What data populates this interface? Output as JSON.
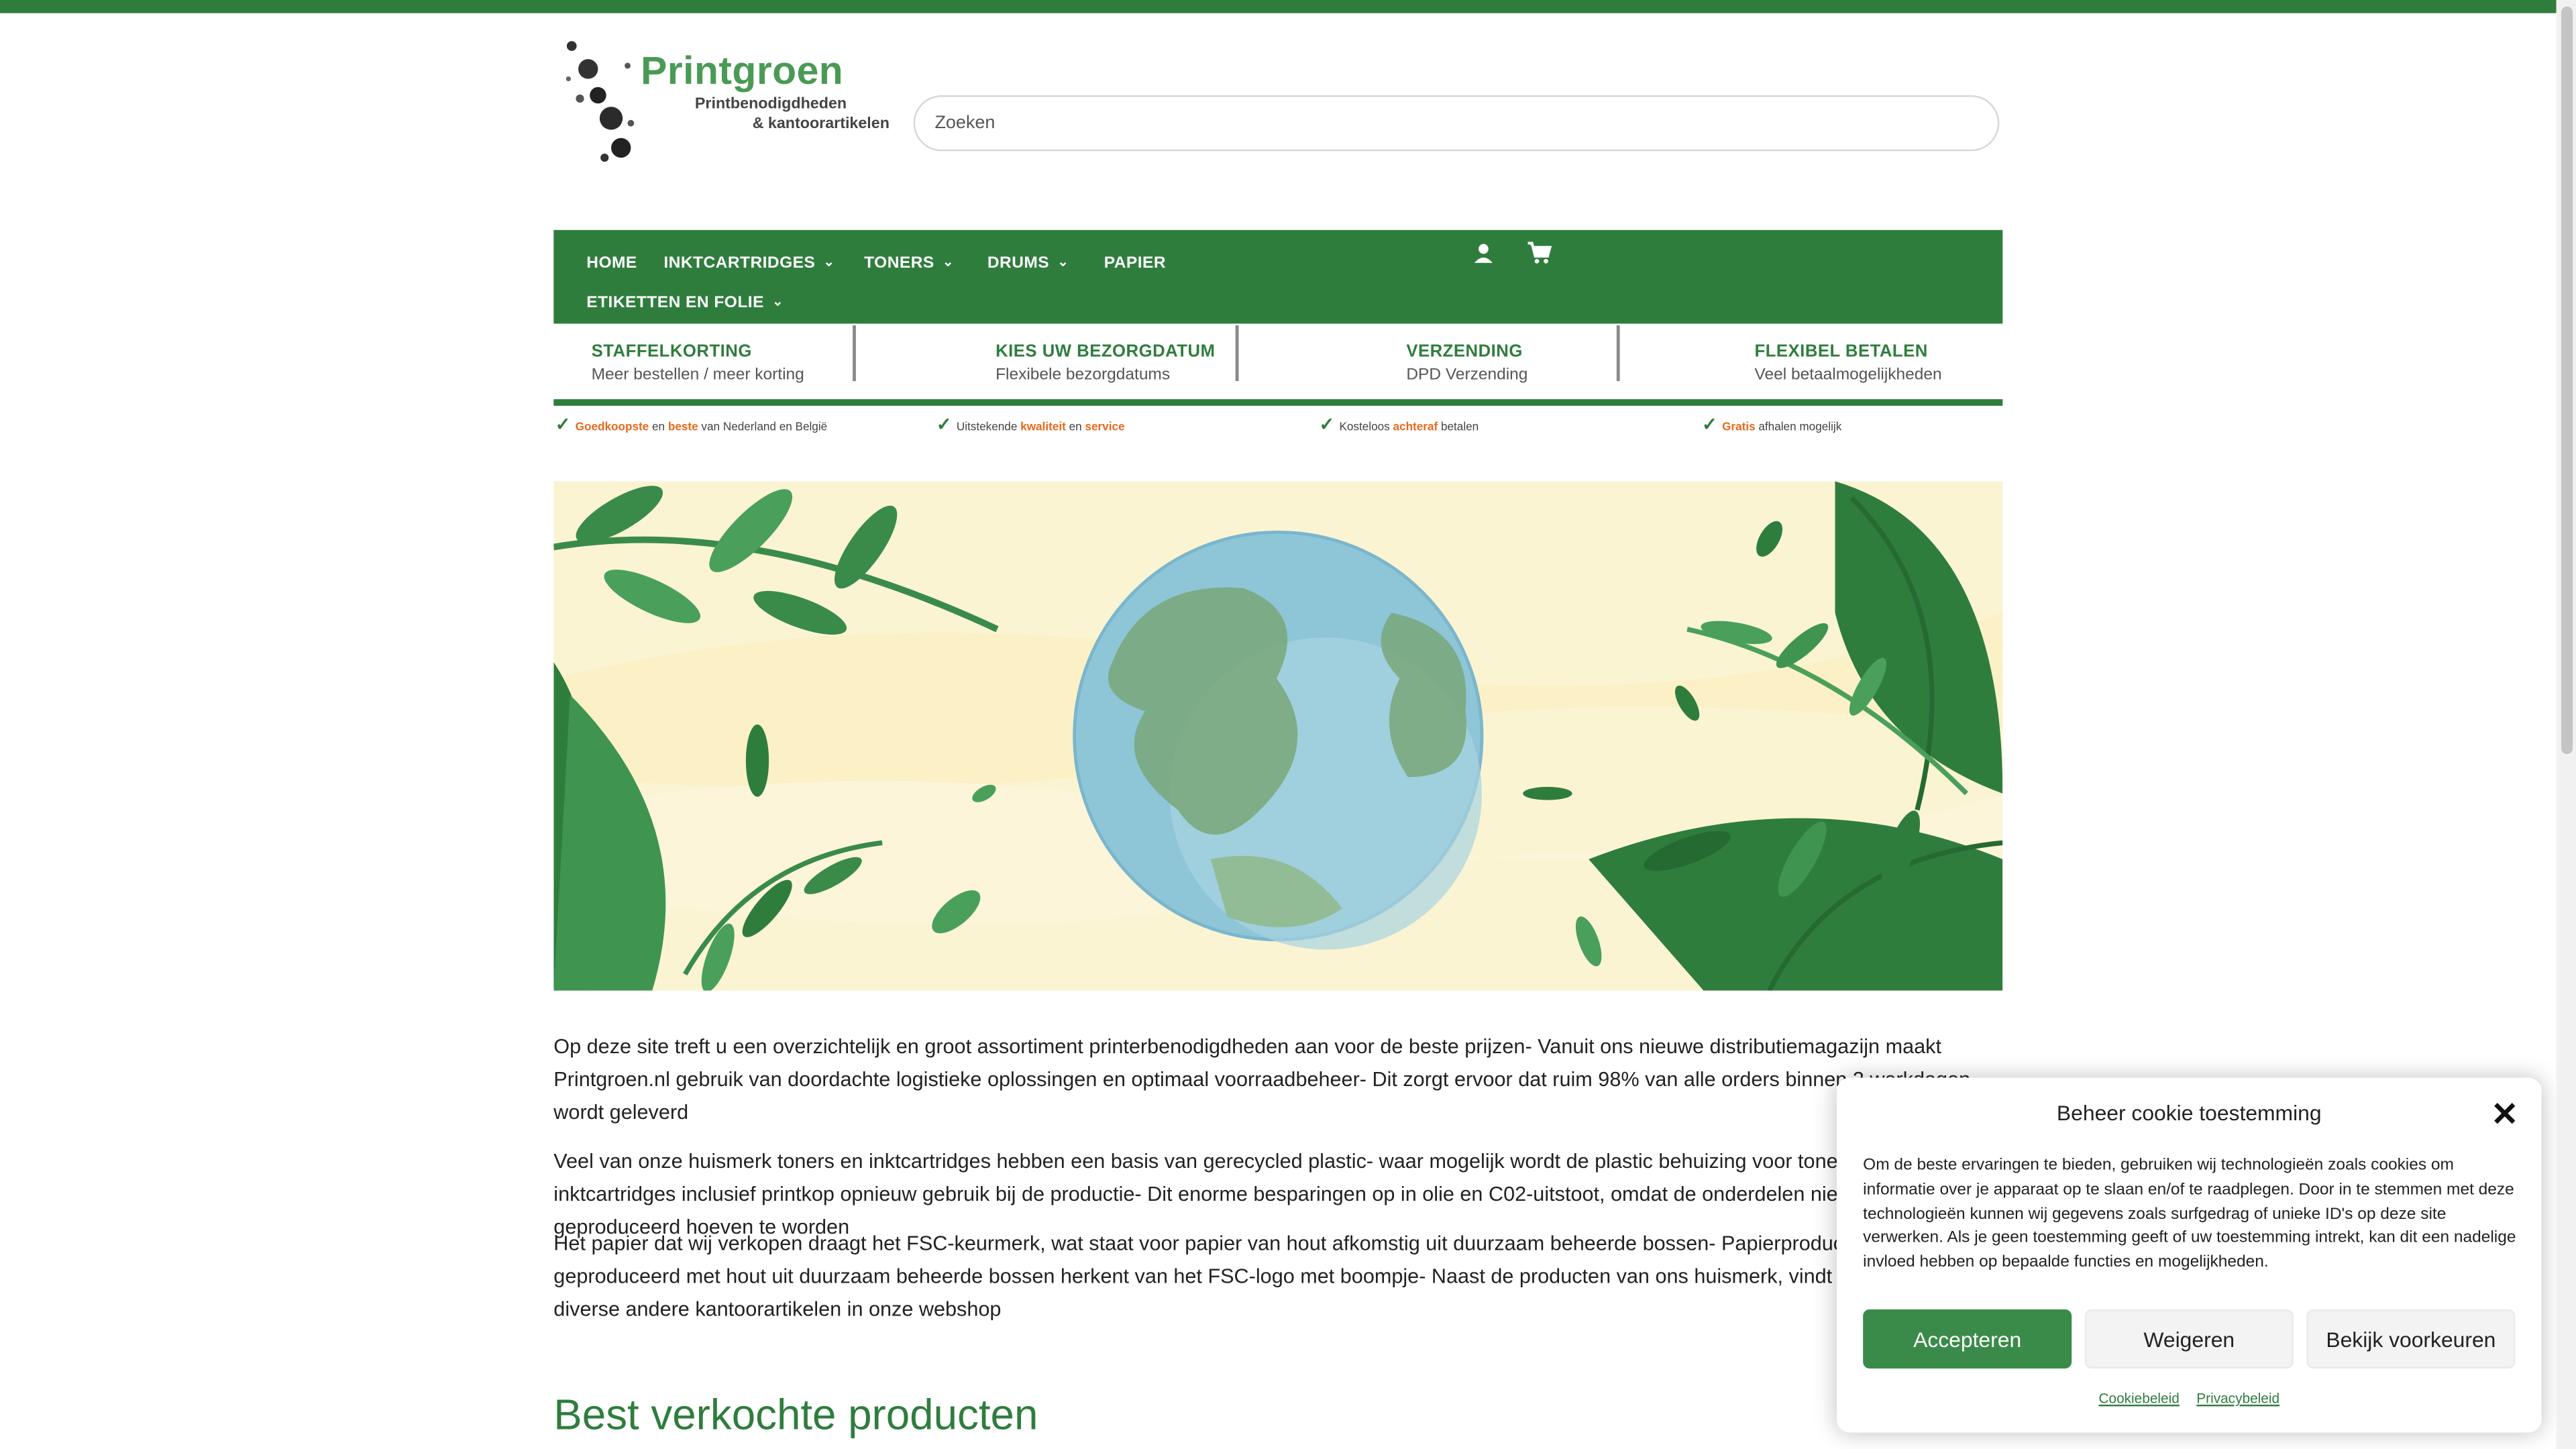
{
  "logo": {
    "title": "Printgroen",
    "subtitle_line1": "Printbenodigdheden",
    "subtitle_line2": "& kantoorartikelen"
  },
  "search": {
    "placeholder": "Zoeken"
  },
  "nav": {
    "items": [
      {
        "label": "HOME",
        "has_dropdown": false
      },
      {
        "label": "INKTCARTRIDGES",
        "has_dropdown": true
      },
      {
        "label": "TONERS",
        "has_dropdown": true
      },
      {
        "label": "DRUMS",
        "has_dropdown": true
      },
      {
        "label": "PAPIER",
        "has_dropdown": false
      },
      {
        "label": "ETIKETTEN EN FOLIE",
        "has_dropdown": true
      }
    ],
    "icons": [
      "account-icon",
      "cart-icon"
    ]
  },
  "usps": [
    {
      "title": "STAFFELKORTING",
      "subtitle": "Meer bestellen / meer korting"
    },
    {
      "title": "KIES UW BEZORGDATUM",
      "subtitle": "Flexibele bezorgdatums"
    },
    {
      "title": "VERZENDING",
      "subtitle": "DPD Verzending"
    },
    {
      "title": "FLEXIBEL BETALEN",
      "subtitle": "Veel betaalmogelijkheden"
    }
  ],
  "checks": [
    {
      "parts": [
        {
          "t": "Goedkoopste",
          "hl": true
        },
        {
          "t": " en ",
          "hl": false
        },
        {
          "t": "beste",
          "hl": true
        },
        {
          "t": " van Nederland en België",
          "hl": false
        }
      ]
    },
    {
      "parts": [
        {
          "t": "Uitstekende ",
          "hl": false
        },
        {
          "t": "kwaliteit",
          "hl": true
        },
        {
          "t": " en ",
          "hl": false
        },
        {
          "t": "service",
          "hl": true
        }
      ]
    },
    {
      "parts": [
        {
          "t": "Kosteloos ",
          "hl": false
        },
        {
          "t": "achteraf",
          "hl": true
        },
        {
          "t": " betalen",
          "hl": false
        }
      ]
    },
    {
      "parts": [
        {
          "t": "Gratis",
          "hl": true
        },
        {
          "t": " afhalen mogelijk",
          "hl": false
        }
      ]
    }
  ],
  "content": {
    "paragraph1": "Op deze site treft u een overzichtelijk en groot assortiment printerbenodigdheden aan voor de beste prijzen- Vanuit ons nieuwe distributiemagazijn maakt Printgroen.nl gebruik van doordachte logistieke oplossingen en optimaal voorraadbeheer- Dit zorgt ervoor dat ruim 98% van alle orders binnen 2 werkdagen wordt geleverd",
    "paragraph2": "Veel van onze huismerk toners en inktcartridges hebben een basis van gerecycled plastic- waar mogelijk wordt de plastic behuizing voor toners en inktcartridges inclusief printkop opnieuw gebruik bij de productie- Dit enorme besparingen op in olie en C02-uitstoot, omdat de onderdelen niet opnieuw geproduceerd hoeven te worden",
    "paragraph3": "Het papier dat wij verkopen draagt het FSC-keurmerk, wat staat voor papier van hout afkomstig uit duurzaam beheerde bossen- Papierproducten die zijn geproduceerd met hout uit duurzaam beheerde bossen herkent van het FSC-logo met boompje- Naast de producten van ons huismerk, vindt u dit het ook diverse andere kantoorartikelen in onze webshop",
    "heading": "Best verkochte producten"
  },
  "cookie": {
    "title": "Beheer cookie toestemming",
    "text": "Om de beste ervaringen te bieden, gebruiken wij technologieën zoals cookies om informatie over je apparaat op te slaan en/of te raadplegen. Door in te stemmen met deze technologieën kunnen wij gegevens zoals surfgedrag of unieke ID's op deze site verwerken. Als je geen toestemming geeft of uw toestemming intrekt, kan dit een nadelige invloed hebben op bepaalde functies en mogelijkheden.",
    "accept": "Accepteren",
    "deny": "Weigeren",
    "preferences": "Bekijk voorkeuren",
    "link1": "Cookiebeleid",
    "link2": "Privacybeleid"
  },
  "colors": {
    "brand_green": "#2f7d3d",
    "accent_orange": "#e8691c",
    "hero_bg": "#faf4d3"
  }
}
